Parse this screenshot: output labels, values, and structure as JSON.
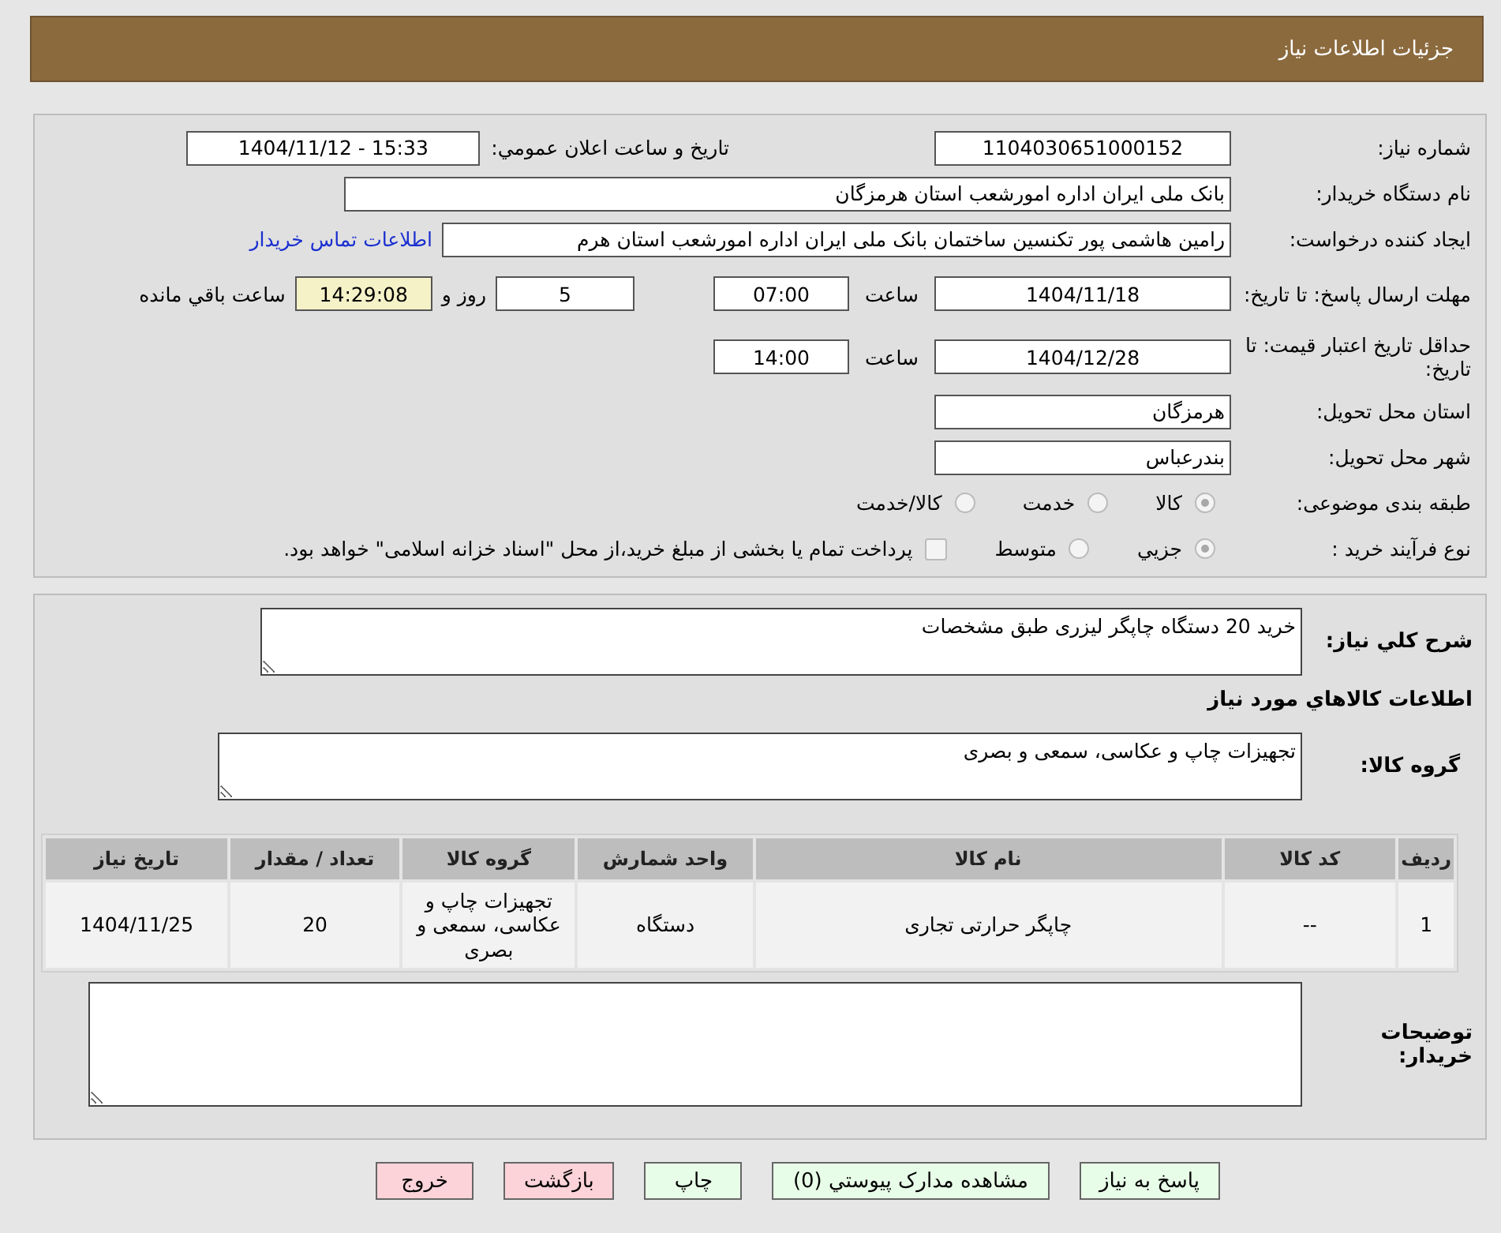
{
  "header": {
    "title": "جزئیات اطلاعات نیاز"
  },
  "details": {
    "need_number": {
      "label": "شماره نیاز:",
      "value": "1104030651000152"
    },
    "announce": {
      "label": "تاریخ و ساعت اعلان عمومي:",
      "value": "1404/11/12 - 15:33"
    },
    "buyer": {
      "label": "نام دستگاه خریدار:",
      "value": "بانک ملی ایران اداره امورشعب استان هرمزگان"
    },
    "requester": {
      "label": "ایجاد کننده درخواست:",
      "value": "رامین هاشمی پور تکنسین ساختمان بانک ملی ایران اداره امورشعب استان هرم",
      "link": "اطلاعات تماس خریدار"
    },
    "deadline": {
      "label": "مهلت ارسال پاسخ: تا تاریخ:",
      "date": "1404/11/18",
      "time_label": "ساعت",
      "time": "07:00",
      "days": "5",
      "days_label": "روز و",
      "remaining": "14:29:08",
      "remaining_label": "ساعت باقي مانده"
    },
    "validity": {
      "label": "حداقل تاریخ اعتبار قیمت: تا تاریخ:",
      "date": "1404/12/28",
      "time_label": "ساعت",
      "time": "14:00"
    },
    "province": {
      "label": "استان محل تحویل:",
      "value": "هرمزگان"
    },
    "city": {
      "label": "شهر محل تحویل:",
      "value": "بندرعباس"
    },
    "category": {
      "label": "طبقه بندی موضوعی:",
      "options": [
        {
          "label": "کالا",
          "selected": true
        },
        {
          "label": "خدمت",
          "selected": false
        },
        {
          "label": "کالا/خدمت",
          "selected": false
        }
      ]
    },
    "process": {
      "label": "نوع فرآیند خرید :",
      "options": [
        {
          "label": "جزیي",
          "selected": true
        },
        {
          "label": "متوسط",
          "selected": false
        }
      ],
      "treasury": {
        "checked": false,
        "text": "پرداخت تمام یا بخشی از مبلغ خرید،از محل \"اسناد خزانه اسلامی\" خواهد بود."
      }
    }
  },
  "needs": {
    "description": {
      "label": "شرح کلي نیاز:",
      "value": "خرید 20 دستگاه چاپگر لیزری طبق مشخصات"
    },
    "goods_heading": "اطلاعات کالاهاي مورد نیاز",
    "goods_group": {
      "label": "گروه کالا:",
      "value": "تجهیزات چاپ و عکاسی، سمعی و بصری"
    },
    "table": {
      "columns": [
        "ردیف",
        "کد کالا",
        "نام کالا",
        "واحد شمارش",
        "گروه کالا",
        "تعداد / مقدار",
        "تاریخ نیاز"
      ],
      "rows": [
        [
          "1",
          "--",
          "چاپگر حرارتی تجاری",
          "دستگاه",
          "تجهیزات چاپ و عکاسی، سمعی و بصری",
          "20",
          "1404/11/25"
        ]
      ]
    },
    "buyer_notes": {
      "label": "توضیحات خریدار:"
    }
  },
  "buttons": [
    {
      "label": "پاسخ به نیاز",
      "kind": "normal"
    },
    {
      "label": "مشاهده مدارک پیوستي (0)",
      "kind": "normal"
    },
    {
      "label": "چاپ",
      "kind": "normal"
    },
    {
      "label": "بازگشت",
      "kind": "danger"
    },
    {
      "label": "خروج",
      "kind": "danger"
    }
  ]
}
